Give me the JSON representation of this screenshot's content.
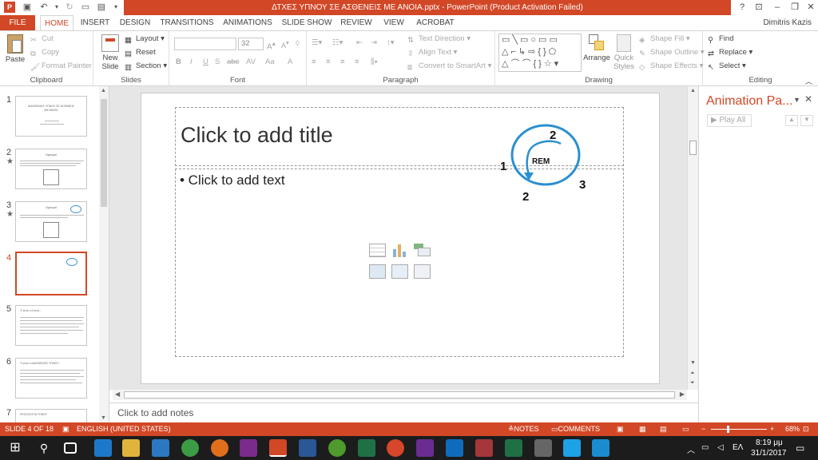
{
  "window": {
    "title": "ΔΤΧΕΣ ΥΠΝΟΥ ΣΕ ΑΣΘΕΝΕΙΣ ΜΕ ΑΝΟΙΑ.pptx - PowerPoint (Product Activation Failed)",
    "help_glyph": "?",
    "minimize_glyph": "–",
    "restore_glyph": "❐",
    "close_glyph": "✕",
    "user_name": "Dimitris Kazis",
    "accent": "#d24726"
  },
  "tabs": [
    "FILE",
    "HOME",
    "INSERT",
    "DESIGN",
    "TRANSITIONS",
    "ANIMATIONS",
    "SLIDE SHOW",
    "REVIEW",
    "VIEW",
    "ACROBAT"
  ],
  "ribbon": {
    "clipboard": {
      "paste": "Paste",
      "cut": "Cut",
      "copy": "Copy",
      "format_painter": "Format Painter",
      "label": "Clipboard"
    },
    "slides": {
      "new_slide": "New Slide",
      "layout": "Layout",
      "reset": "Reset",
      "section": "Section",
      "label": "Slides"
    },
    "font": {
      "font_size": "32",
      "label": "Font"
    },
    "paragraph": {
      "text_direction": "Text Direction",
      "align_text": "Align Text",
      "convert_smartart": "Convert to SmartArt",
      "label": "Paragraph"
    },
    "drawing": {
      "arrange": "Arrange",
      "quick_styles": "Quick Styles",
      "shape_fill": "Shape Fill",
      "shape_outline": "Shape Outline",
      "shape_effects": "Shape Effects",
      "label": "Drawing"
    },
    "editing": {
      "find": "Find",
      "replace": "Replace",
      "select": "Select",
      "label": "Editing"
    }
  },
  "thumbnails": [
    {
      "num": "1",
      "star": false,
      "lines": [
        "ΔΙΑΤΑΡΑΧΕΣ ΥΠΝΟΥ ΣΕ ΑΣΘΕΝΕΙΣ",
        "ΜΕ ΑΝΟΙΑ"
      ]
    },
    {
      "num": "2",
      "star": true,
      "lines": [
        "Ορισμοί"
      ]
    },
    {
      "num": "3",
      "star": true,
      "lines": [
        "Ορισμοί"
      ]
    },
    {
      "num": "4",
      "star": false,
      "lines": []
    },
    {
      "num": "5",
      "star": false,
      "lines": [
        "Τι είναι ο ύπνος ;"
      ]
    },
    {
      "num": "6",
      "star": false,
      "lines": [
        "Τι είναι ο ΔΙΑΤΑΡΑΧΕΣ ΥΠΝΟΥ ;"
      ]
    },
    {
      "num": "7",
      "star": false,
      "lines": [
        "ΦΥΣΙΟΛΟΓΙΑ ΥΠΝΟΥ"
      ]
    }
  ],
  "slide": {
    "title_placeholder": "Click to add title",
    "body_placeholder": "• Click to add text",
    "diagram": {
      "center_label": "REM",
      "n1": "1",
      "n2_top": "2",
      "n2_bottom": "2",
      "n3": "3"
    }
  },
  "notes_placeholder": "Click to add notes",
  "animation_pane": {
    "title": "Animation Pa...",
    "play_all": "Play All"
  },
  "status": {
    "slide_info": "SLIDE 4 OF 18",
    "language": "ENGLISH (UNITED STATES)",
    "notes": "NOTES",
    "comments": "COMMENTS",
    "zoom": "68%"
  },
  "taskbar": {
    "language": "ΕΛ",
    "time": "8:19 μμ",
    "date": "31/1/2017"
  }
}
